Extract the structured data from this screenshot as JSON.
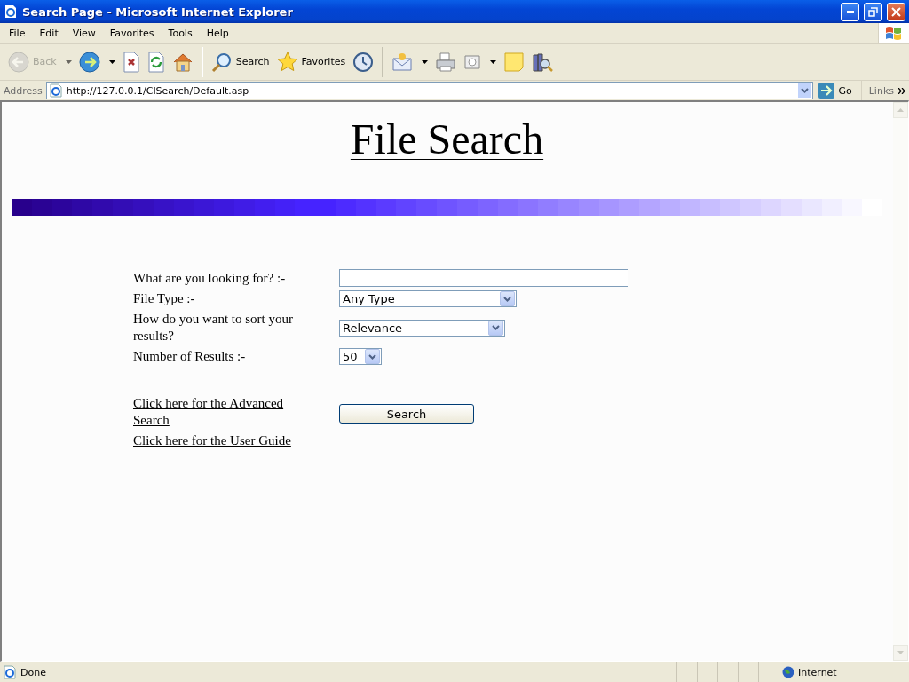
{
  "window": {
    "title": "Search Page - Microsoft Internet Explorer"
  },
  "menu": [
    "File",
    "Edit",
    "View",
    "Favorites",
    "Tools",
    "Help"
  ],
  "toolbar": [
    {
      "kind": "back",
      "label": "Back",
      "disabled": true,
      "dropdown": true
    },
    {
      "kind": "forward",
      "disabled": false,
      "dropdown": true
    },
    {
      "kind": "stop",
      "disabled": false,
      "dropdown": false
    },
    {
      "kind": "refresh",
      "disabled": false,
      "dropdown": false
    },
    {
      "kind": "home",
      "disabled": false,
      "dropdown": false
    },
    {
      "kind": "sep"
    },
    {
      "kind": "search",
      "label": "Search",
      "disabled": false,
      "dropdown": false
    },
    {
      "kind": "favorites",
      "label": "Favorites",
      "disabled": false,
      "dropdown": false
    },
    {
      "kind": "history",
      "disabled": false,
      "dropdown": false
    },
    {
      "kind": "sep"
    },
    {
      "kind": "mail",
      "disabled": false,
      "dropdown": true
    },
    {
      "kind": "print",
      "disabled": false,
      "dropdown": false
    },
    {
      "kind": "edit",
      "disabled": false,
      "dropdown": true
    },
    {
      "kind": "note",
      "disabled": false,
      "dropdown": false
    },
    {
      "kind": "research",
      "disabled": false,
      "dropdown": false
    }
  ],
  "address": {
    "label": "Address",
    "url": "http://127.0.0.1/CISearch/Default.asp",
    "go": "Go",
    "links": "Links"
  },
  "page": {
    "heading": "File Search",
    "fields": [
      {
        "kind": "text",
        "label": "What are you looking for? :-"
      },
      {
        "kind": "select",
        "label": "File Type :-",
        "value": "Any Type"
      },
      {
        "kind": "select",
        "label": "How do you want to sort your results?",
        "value": "Relevance"
      },
      {
        "kind": "select",
        "label": "Number of Results :-",
        "value": "50"
      }
    ],
    "links": [
      "Click here for the Advanced Search",
      "Click here for the User Guide"
    ],
    "button": "Search"
  },
  "status_bar": {
    "text": "Done",
    "zone": "Internet"
  }
}
